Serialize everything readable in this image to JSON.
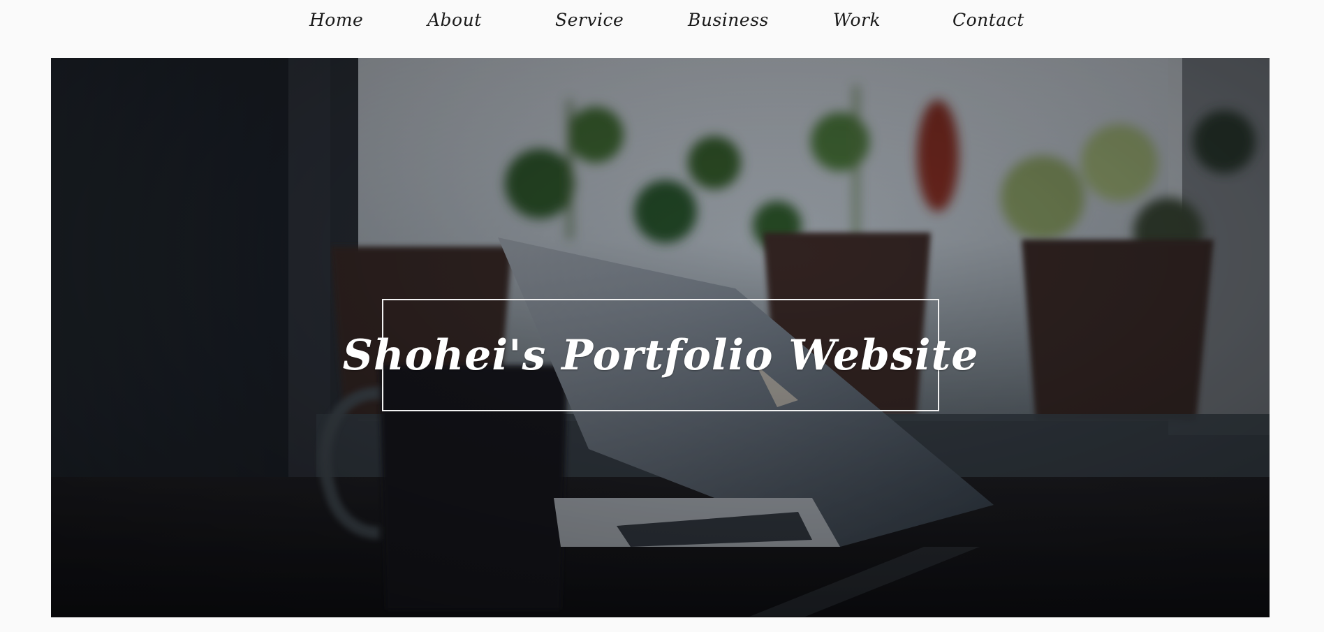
{
  "nav": {
    "items": [
      {
        "label": "Home"
      },
      {
        "label": "About"
      },
      {
        "label": "Service"
      },
      {
        "label": "Business"
      },
      {
        "label": "Work"
      },
      {
        "label": "Contact"
      }
    ]
  },
  "hero": {
    "title": "Shohei's Portfolio Website",
    "image": "laptop-with-plants-photo"
  },
  "colors": {
    "page_background": "#fafafa",
    "nav_text": "#1a1a1a",
    "title_text": "#ffffff",
    "title_border": "#f2f2f2"
  }
}
